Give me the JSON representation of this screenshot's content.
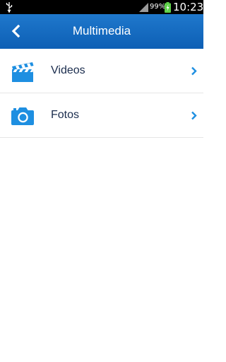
{
  "status_bar": {
    "battery_percent": "99%",
    "time": "10:23",
    "icons": [
      "usb-icon",
      "signal-icon",
      "battery-charging-icon"
    ]
  },
  "header": {
    "title": "Multimedia",
    "back_icon": "back-chevron-icon"
  },
  "menu": {
    "items": [
      {
        "label": "Videos",
        "icon": "clapperboard-icon"
      },
      {
        "label": "Fotos",
        "icon": "camera-icon"
      }
    ]
  },
  "colors": {
    "header": "#1565c0",
    "accent": "#1e8fe1",
    "text": "#1a2c4d"
  }
}
